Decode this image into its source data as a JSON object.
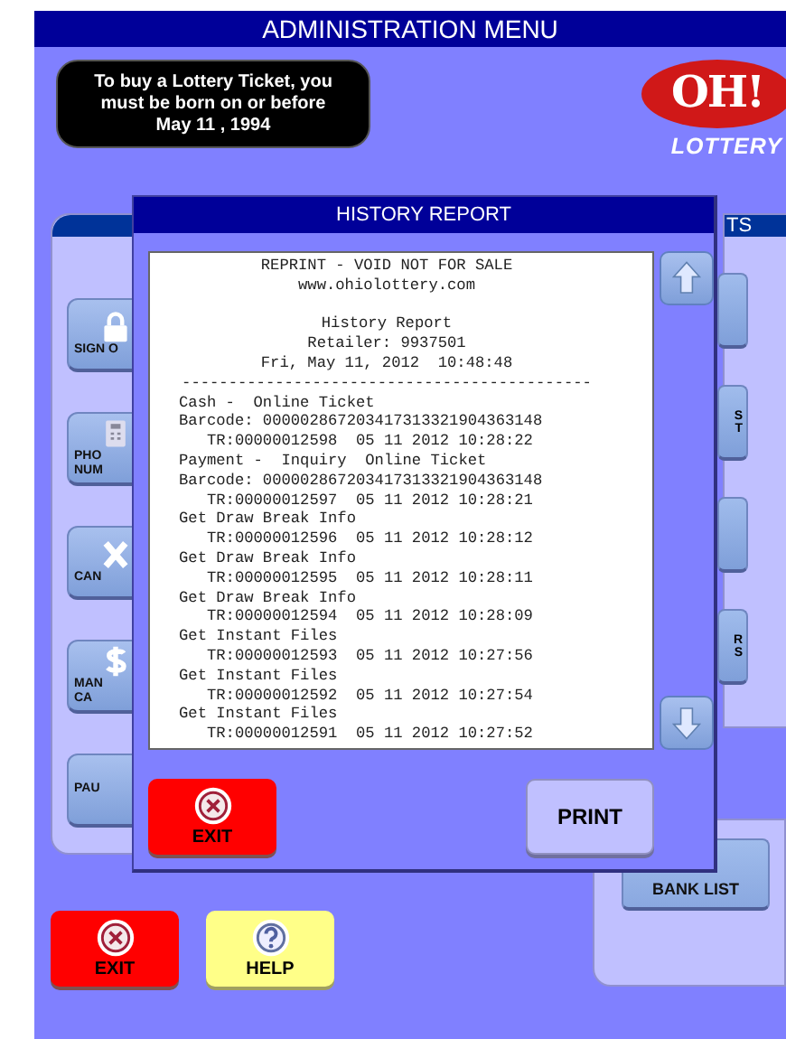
{
  "header": {
    "title": "ADMINISTRATION MENU"
  },
  "age_notice": {
    "lines": [
      "To buy a Lottery Ticket, you",
      "must be born on or before",
      "May 11 , 1994"
    ]
  },
  "logo": {
    "mark": "OH!",
    "word": "LOTTERY"
  },
  "left_panel": {
    "buttons": [
      {
        "kind": "lock",
        "label": [
          "SIGN O"
        ]
      },
      {
        "kind": "phone",
        "label": [
          "PHO",
          "NUM"
        ]
      },
      {
        "kind": "cancel",
        "label": [
          "CAN"
        ]
      },
      {
        "kind": "money",
        "label": [
          "MAN",
          "CA"
        ]
      },
      {
        "kind": "plain",
        "label": [
          "PAU"
        ]
      }
    ]
  },
  "right_panel": {
    "header": "TS",
    "buttons": [
      {
        "kind": "blank"
      },
      {
        "kind": "labeled",
        "label": [
          "S",
          "T"
        ]
      },
      {
        "kind": "blank"
      },
      {
        "kind": "labeled",
        "label": [
          "R",
          "S"
        ]
      }
    ]
  },
  "bank_list_button": "BANK LIST",
  "footer_buttons": [
    {
      "kind": "exit",
      "label": "EXIT"
    },
    {
      "kind": "help",
      "label": "HELP"
    }
  ],
  "modal": {
    "title": "HISTORY REPORT",
    "report": {
      "masthead_lines": [
        "REPRINT - VOID NOT FOR SALE",
        "www.ohiolottery.com"
      ],
      "header_lines": [
        "History Report",
        "Retailer: 9937501",
        "Fri, May 11, 2012  10:48:48",
        "--------------------------------------------"
      ],
      "lines": [
        "Cash -  Online Ticket",
        "Barcode: 000002867203417313321904363148",
        "   TR:00000012598  05 11 2012 10:28:22",
        "Payment -  Inquiry  Online Ticket",
        "Barcode: 000002867203417313321904363148",
        "   TR:00000012597  05 11 2012 10:28:21",
        "Get Draw Break Info",
        "   TR:00000012596  05 11 2012 10:28:12",
        "Get Draw Break Info",
        "   TR:00000012595  05 11 2012 10:28:11",
        "Get Draw Break Info",
        "   TR:00000012594  05 11 2012 10:28:09",
        "Get Instant Files",
        "   TR:00000012593  05 11 2012 10:27:56",
        "Get Instant Files",
        "   TR:00000012592  05 11 2012 10:27:54",
        "Get Instant Files",
        "   TR:00000012591  05 11 2012 10:27:52"
      ]
    },
    "buttons": [
      {
        "kind": "exit",
        "label": "EXIT"
      },
      {
        "kind": "print",
        "label": "PRINT"
      }
    ]
  }
}
